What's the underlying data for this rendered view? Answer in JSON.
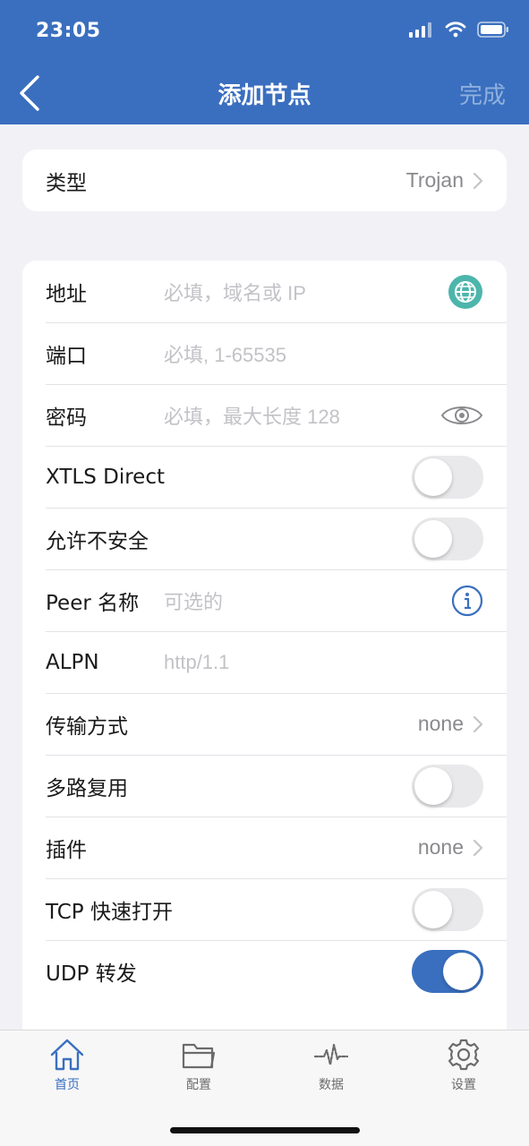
{
  "status_bar": {
    "time": "23:05"
  },
  "nav": {
    "title": "添加节点",
    "done_label": "完成"
  },
  "type_row": {
    "label": "类型",
    "value": "Trojan"
  },
  "form": {
    "address": {
      "label": "地址",
      "placeholder": "必填，域名或 IP"
    },
    "port": {
      "label": "端口",
      "placeholder": "必填, 1-65535"
    },
    "password": {
      "label": "密码",
      "placeholder": "必填，最大长度 128"
    },
    "xtls_direct": {
      "label": "XTLS Direct",
      "on": false
    },
    "allow_insecure": {
      "label": "允许不安全",
      "on": false
    },
    "peer_name": {
      "label": "Peer 名称",
      "placeholder": "可选的"
    },
    "alpn": {
      "label": "ALPN",
      "placeholder": "http/1.1"
    },
    "transport": {
      "label": "传输方式",
      "value": "none"
    },
    "multiplex": {
      "label": "多路复用",
      "on": false
    },
    "plugin": {
      "label": "插件",
      "value": "none"
    },
    "tcp_fast_open": {
      "label": "TCP 快速打开",
      "on": false
    },
    "udp_relay": {
      "label": "UDP 转发",
      "on": true
    }
  },
  "tabs": [
    {
      "label": "首页",
      "icon": "home-icon",
      "active": true
    },
    {
      "label": "配置",
      "icon": "folder-icon",
      "active": false
    },
    {
      "label": "数据",
      "icon": "pulse-icon",
      "active": false
    },
    {
      "label": "设置",
      "icon": "gear-icon",
      "active": false
    }
  ],
  "colors": {
    "accent": "#3a6fbf",
    "globe": "#4db6ac"
  }
}
